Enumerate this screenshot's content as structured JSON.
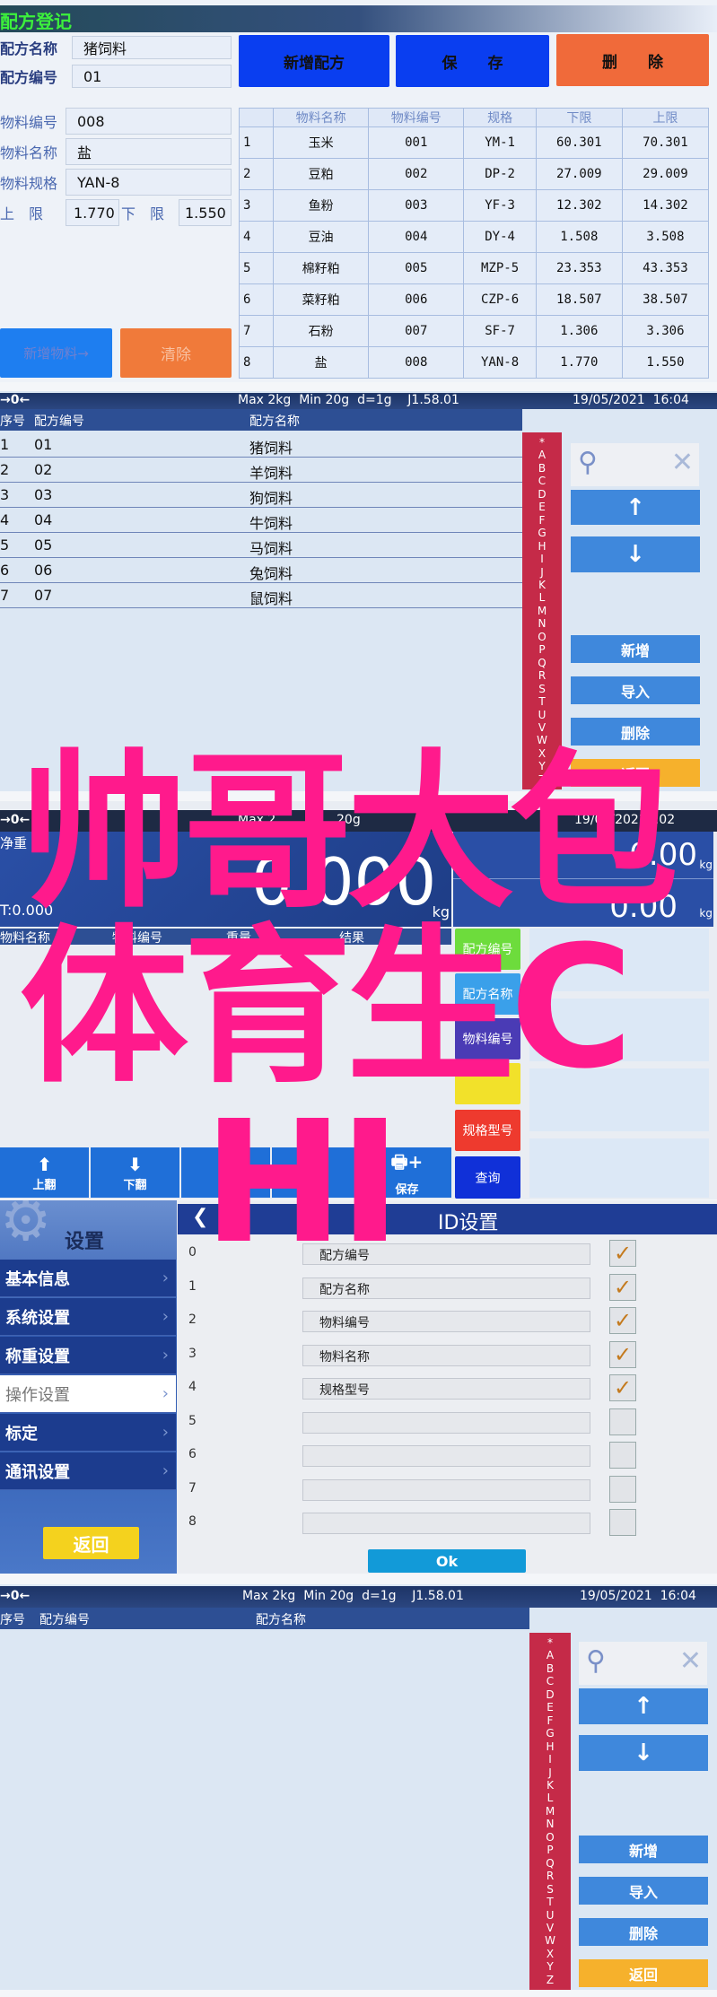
{
  "recipe_register": {
    "title": "配方登记",
    "recipe_name_label": "配方名称",
    "recipe_name": "猪饲料",
    "recipe_no_label": "配方编号",
    "recipe_no": "01",
    "btn_new_recipe": "新增配方",
    "btn_save": "保　　存",
    "btn_delete": "删　　除",
    "material_no_label": "物料编号",
    "material_no": "008",
    "material_name_label": "物料名称",
    "material_name": "盐",
    "material_spec_label": "物料规格",
    "material_spec": "YAN-8",
    "upper_label": "上　限",
    "upper": "1.770",
    "lower_label": "下　限",
    "lower": "1.550",
    "btn_add_material": "新增物料→",
    "btn_clear": "清除",
    "table": {
      "headers": [
        "",
        "物料名称",
        "物料编号",
        "规格",
        "下限",
        "上限"
      ],
      "rows": [
        [
          "1",
          "玉米",
          "001",
          "YM-1",
          "60.301",
          "70.301"
        ],
        [
          "2",
          "豆粕",
          "002",
          "DP-2",
          "27.009",
          "29.009"
        ],
        [
          "3",
          "鱼粉",
          "003",
          "YF-3",
          "12.302",
          "14.302"
        ],
        [
          "4",
          "豆油",
          "004",
          "DY-4",
          "1.508",
          "3.508"
        ],
        [
          "5",
          "棉籽粕",
          "005",
          "MZP-5",
          "23.353",
          "43.353"
        ],
        [
          "6",
          "菜籽粕",
          "006",
          "CZP-6",
          "18.507",
          "38.507"
        ],
        [
          "7",
          "石粉",
          "007",
          "SF-7",
          "1.306",
          "3.306"
        ],
        [
          "8",
          "盐",
          "008",
          "YAN-8",
          "1.770",
          "1.550"
        ]
      ]
    }
  },
  "recipe_list": {
    "status": "Max 2kg  Min 20g  d=1g    J1.58.01",
    "datetime": "19/05/2021  16:04",
    "zero_icon": "→0←",
    "col_seq": "序号",
    "col_no": "配方编号",
    "col_name": "配方名称",
    "rows": [
      [
        "1",
        "01",
        "猪饲料"
      ],
      [
        "2",
        "02",
        "羊饲料"
      ],
      [
        "3",
        "03",
        "狗饲料"
      ],
      [
        "4",
        "04",
        "牛饲料"
      ],
      [
        "5",
        "05",
        "马饲料"
      ],
      [
        "6",
        "06",
        "兔饲料"
      ],
      [
        "7",
        "07",
        "鼠饲料"
      ]
    ],
    "alphabet": [
      "*",
      "A",
      "B",
      "C",
      "D",
      "E",
      "F",
      "G",
      "H",
      "I",
      "J",
      "K",
      "L",
      "M",
      "N",
      "O",
      "P",
      "Q",
      "R",
      "S",
      "T",
      "U",
      "V",
      "W",
      "X",
      "Y",
      "Z"
    ],
    "btn_up": "↑",
    "btn_down": "↓",
    "btn_add": "新增",
    "btn_import": "导入",
    "btn_delete": "删除",
    "btn_back": "返回"
  },
  "weighing": {
    "status_left": "Max 2",
    "status_mid": "20g",
    "datetime": "19/05/2021  :02",
    "zero_icon": "→0←",
    "net_label": "净重",
    "net_value": "0.000",
    "tare": "T:0.000",
    "unit": "kg",
    "right_value1": "0.00",
    "right_value2": "0.00",
    "cols": [
      "物料名称",
      "物料编号",
      "重量",
      "结果"
    ],
    "filter_buttons": [
      {
        "label": "配方编号",
        "color": "#6ddc3c"
      },
      {
        "label": "配方名称",
        "color": "#3aa0ea"
      },
      {
        "label": "物料编号",
        "color": "#4a3bb5"
      },
      {
        "label": "",
        "color": "#f2e12a"
      },
      {
        "label": "规格型号",
        "color": "#ee3a2e"
      },
      {
        "label": "查询",
        "color": "#1030d8"
      }
    ],
    "toolbar": [
      "上翻",
      "下翻",
      "",
      "打印",
      "保存"
    ]
  },
  "settings": {
    "title": "设置",
    "page_title": "ID设置",
    "menu": [
      {
        "label": "基本信息",
        "selected": false
      },
      {
        "label": "系统设置",
        "selected": false
      },
      {
        "label": "称重设置",
        "selected": false
      },
      {
        "label": "操作设置",
        "selected": true
      },
      {
        "label": "标定",
        "selected": false
      },
      {
        "label": "通讯设置",
        "selected": false
      }
    ],
    "btn_back": "返回",
    "btn_ok": "Ok",
    "ids": [
      {
        "index": "0",
        "name": "配方编号",
        "checked": true
      },
      {
        "index": "1",
        "name": "配方名称",
        "checked": true
      },
      {
        "index": "2",
        "name": "物料编号",
        "checked": true
      },
      {
        "index": "3",
        "name": "物料名称",
        "checked": true
      },
      {
        "index": "4",
        "name": "规格型号",
        "checked": true
      },
      {
        "index": "5",
        "name": "",
        "checked": false
      },
      {
        "index": "6",
        "name": "",
        "checked": false
      },
      {
        "index": "7",
        "name": "",
        "checked": false
      },
      {
        "index": "8",
        "name": "",
        "checked": false
      }
    ]
  },
  "recipe_list_empty": {
    "status": "Max 2kg  Min 20g  d=1g    J1.58.01",
    "datetime": "19/05/2021  16:04",
    "zero_icon": "→0←",
    "col_seq": "序号",
    "col_no": "配方编号",
    "col_name": "配方名称",
    "btn_up": "↑",
    "btn_down": "↓",
    "btn_add": "新增",
    "btn_import": "导入",
    "btn_delete": "删除",
    "btn_back": "返回"
  },
  "watermark": [
    "帅哥大包",
    "体育生C",
    "HI"
  ]
}
